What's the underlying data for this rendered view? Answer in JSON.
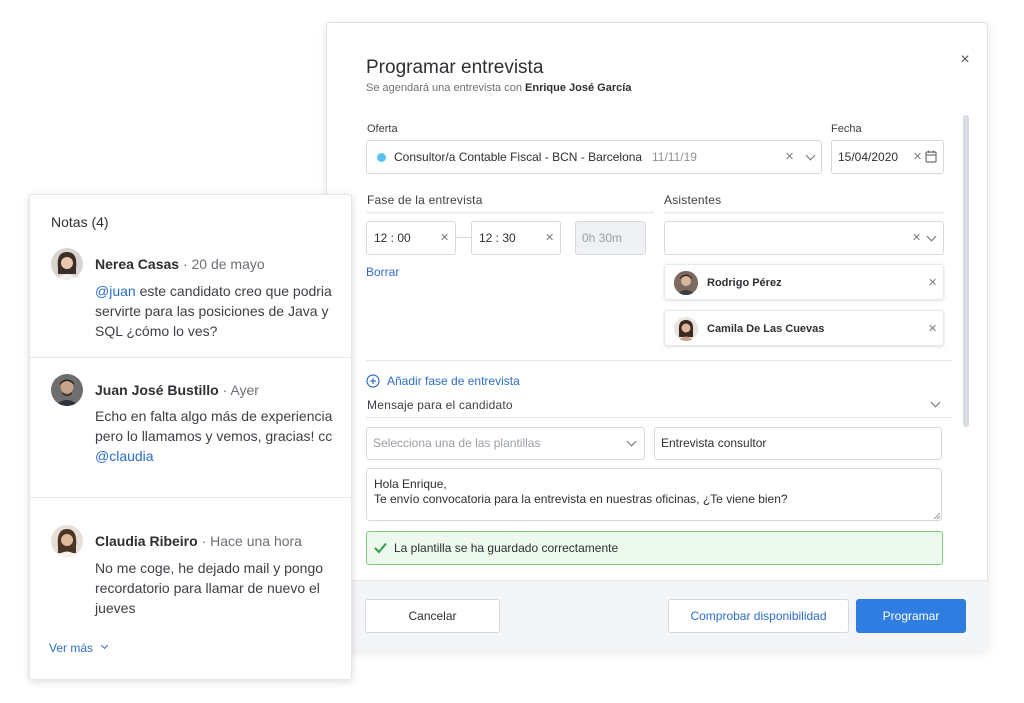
{
  "modal": {
    "title": "Programar entrevista",
    "subtitle_prefix": "Se agendará una entrevista con",
    "candidate_name": "Enrique José García",
    "close_icon": "×"
  },
  "offer": {
    "label": "Oferta",
    "value": "Consultor/a Contable Fiscal - BCN - Barcelona",
    "date": "11/11/19",
    "status_color": "#5bc0f5"
  },
  "date_field": {
    "label": "Fecha",
    "value": "15/04/2020"
  },
  "phase": {
    "label": "Fase de la entrevista",
    "start_time": "12 : 00",
    "end_time": "12 : 30",
    "duration": "0h 30m",
    "clear_link": "Borrar",
    "add_link": "Añadir fase de entrevista"
  },
  "attendees": {
    "label": "Asistentes",
    "people": [
      {
        "name": "Rodrigo Pérez"
      },
      {
        "name": "Camila De Las Cuevas"
      }
    ]
  },
  "message": {
    "label": "Mensaje para el candidato",
    "template_placeholder": "Selecciona una de las plantillas",
    "template_name": "Entrevista consultor",
    "body_line1": "Hola Enrique,",
    "body_line2": "Te envío convocatoria para la entrevista en nuestras oficinas, ¿Te viene bien?",
    "success_text": "La plantilla se ha guardado correctamente"
  },
  "footer": {
    "cancel": "Cancelar",
    "check": "Comprobar disponibilidad",
    "schedule": "Programar"
  },
  "notes": {
    "title": "Notas (4)",
    "items": [
      {
        "author": "Nerea Casas",
        "time": "· 20 de mayo",
        "mention": "@juan",
        "text": " este candidato creo que podria servirte para las posiciones de Java y SQL ¿cómo lo ves?"
      },
      {
        "author": "Juan José Bustillo",
        "time": "· Ayer",
        "text": "Echo en falta algo más de experiencia pero lo llamamos y vemos, gracias! cc ",
        "mention": "@claudia"
      },
      {
        "author": "Claudia Ribeiro",
        "time": "· Hace una hora",
        "text": "No me coge, he dejado mail y pongo recordatorio para llamar de nuevo el jueves"
      }
    ],
    "more_link": "Ver más"
  },
  "colors": {
    "accent": "#2c6ecb",
    "primary_button": "#2f7de1",
    "success_border": "#7ed07e",
    "success_bg": "#eef9ee",
    "success_check": "#2e9e3e"
  }
}
